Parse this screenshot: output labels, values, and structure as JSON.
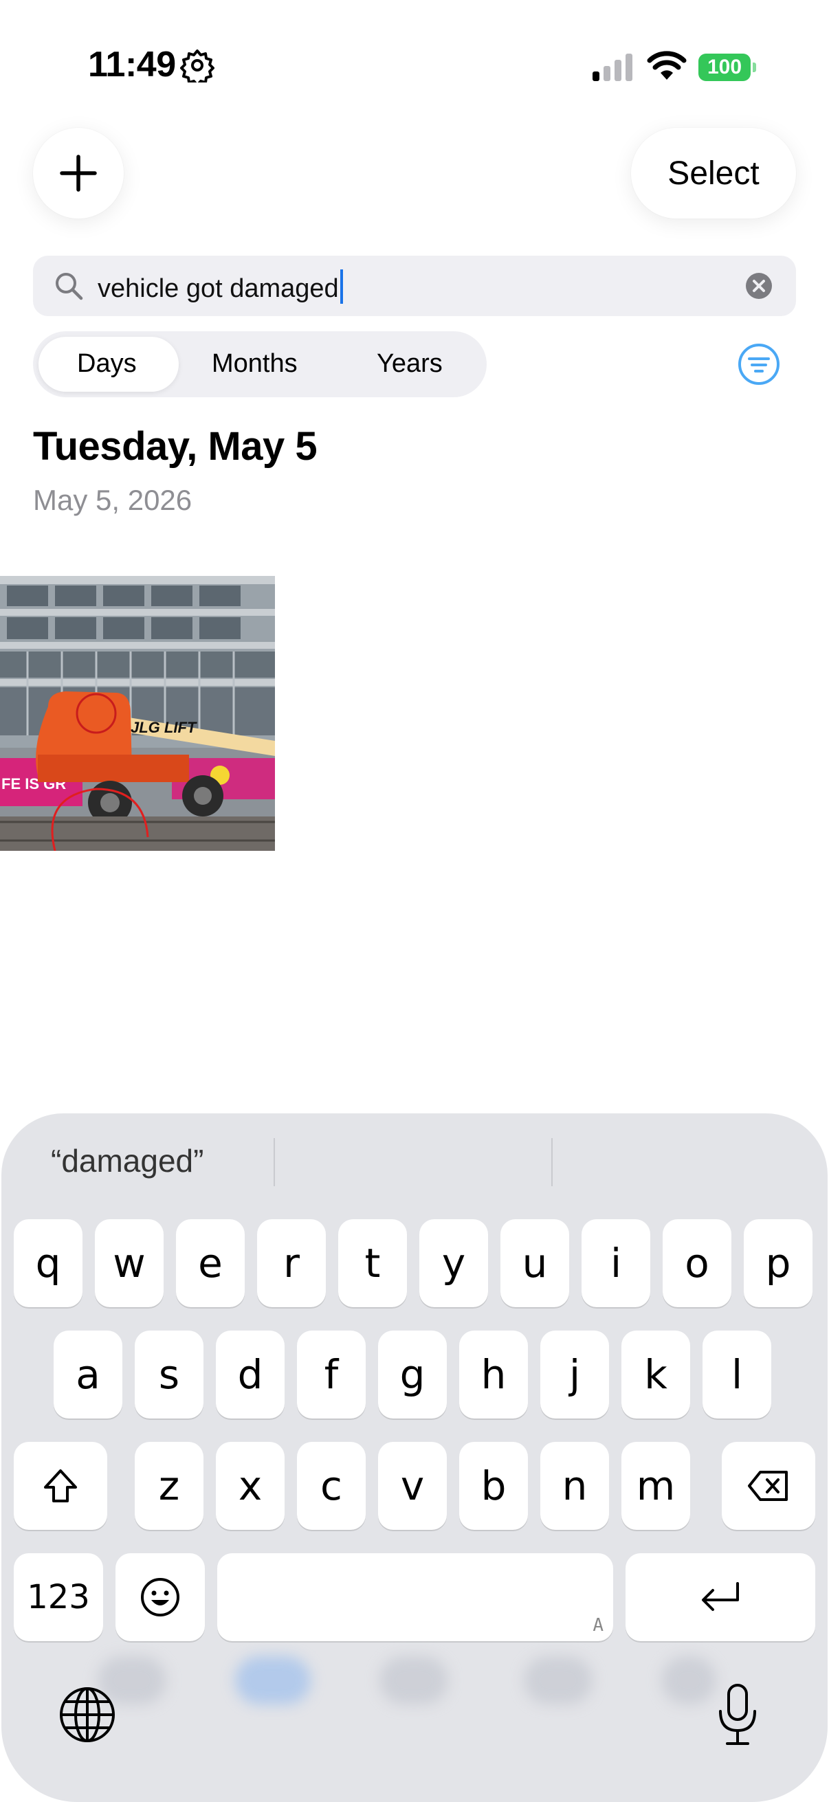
{
  "status_bar": {
    "time": "11:49",
    "battery": "100",
    "battery_color": "#34c759"
  },
  "toolbar": {
    "add_icon": "plus-icon",
    "select_label": "Select"
  },
  "search": {
    "value": "vehicle got damaged",
    "icon": "search-icon",
    "clear_icon": "clear-icon"
  },
  "segments": {
    "items": [
      "Days",
      "Months",
      "Years"
    ],
    "selected": "Days"
  },
  "filter_icon": "filter-icon",
  "section": {
    "title": "Tuesday, May 5",
    "subtitle": "May 5, 2026"
  },
  "photo": {
    "description_icon": "photo-thumbnail"
  },
  "keyboard": {
    "suggestions": [
      "“damaged”",
      "",
      ""
    ],
    "row1": [
      "q",
      "w",
      "e",
      "r",
      "t",
      "y",
      "u",
      "i",
      "o",
      "p"
    ],
    "row2": [
      "a",
      "s",
      "d",
      "f",
      "g",
      "h",
      "j",
      "k",
      "l"
    ],
    "row3": [
      "z",
      "x",
      "c",
      "v",
      "b",
      "n",
      "m"
    ],
    "numbers_key": "123",
    "space_hint": "A"
  },
  "colors": {
    "accent": "#1a73e8",
    "filter_blue": "#4aa8f5"
  }
}
